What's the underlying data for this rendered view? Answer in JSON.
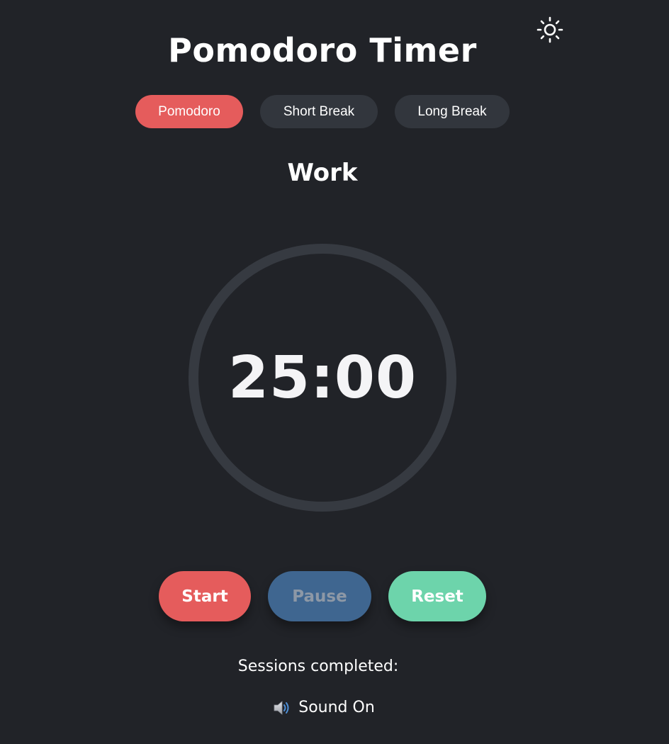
{
  "app": {
    "title": "Pomodoro Timer"
  },
  "header": {
    "theme_icon": "sun-icon"
  },
  "modes": [
    {
      "label": "Pomodoro",
      "active": true
    },
    {
      "label": "Short Break",
      "active": false
    },
    {
      "label": "Long Break",
      "active": false
    }
  ],
  "timer": {
    "phase": "Work",
    "time": "25:00",
    "progress": 0
  },
  "controls": {
    "start_label": "Start",
    "pause_label": "Pause",
    "reset_label": "Reset"
  },
  "sessions": {
    "label": "Sessions completed:"
  },
  "sound": {
    "icon": "speaker-icon",
    "label": "Sound On"
  },
  "colors": {
    "background": "#212328",
    "accent_red": "#e55c5c",
    "pause_blue": "#3f6690",
    "reset_green": "#6dd4ab",
    "ring": "#363a41"
  }
}
